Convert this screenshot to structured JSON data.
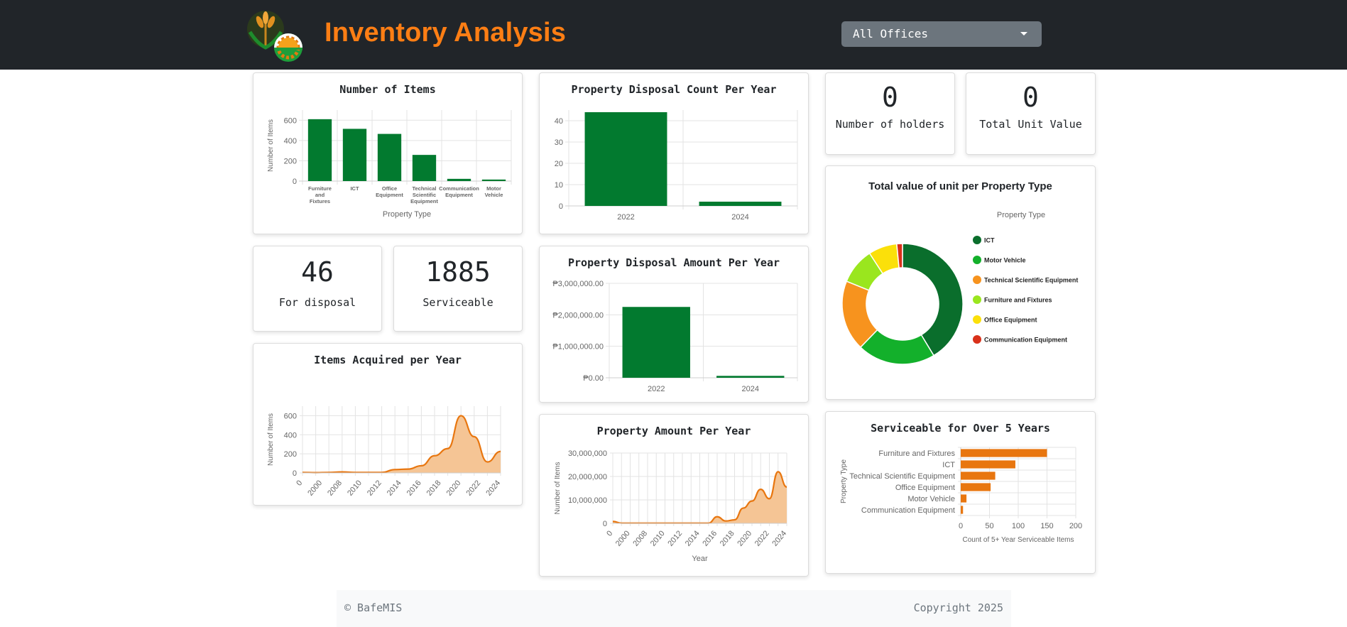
{
  "header": {
    "title": "Inventory Analysis",
    "office_filter": {
      "selected": "All Offices"
    }
  },
  "stats": {
    "for_disposal": {
      "value": "46",
      "label": "For disposal"
    },
    "serviceable": {
      "value": "1885",
      "label": "Serviceable"
    },
    "holders": {
      "value": "0",
      "label": "Number of holders"
    },
    "total_unit_value": {
      "value": "0",
      "label": "Total Unit Value"
    }
  },
  "cards": {
    "items_title": "Number of Items",
    "acquired_title": "Items Acquired per Year",
    "disposal_count_title": "Property Disposal Count Per Year",
    "disposal_amount_title": "Property Disposal Amount Per Year",
    "amount_title": "Property Amount Per Year",
    "donut_title": "Total value of unit per Property Type",
    "serviceable5_title": "Serviceable for Over 5 Years"
  },
  "colors": {
    "green": "#027a2f",
    "orange": "#e8760f",
    "orange_fill": "#f5c595",
    "navbar": "#212529",
    "brand": "#fd7e14"
  },
  "chart_data": [
    {
      "id": "items",
      "type": "bar",
      "title": "Number of Items",
      "xlabel": "Property Type",
      "ylabel": "Number of Items",
      "categories": [
        "Furniture and Fixtures",
        "ICT",
        "Office Equipment",
        "Technical Scientific Equipment",
        "Communication Equipment",
        "Motor Vehicle"
      ],
      "values": [
        610,
        515,
        465,
        258,
        22,
        15
      ],
      "ylim": [
        0,
        700
      ],
      "yticks": [
        0,
        200,
        400,
        600
      ],
      "grid": true
    },
    {
      "id": "acquired",
      "type": "area",
      "title": "Items Acquired per Year",
      "xlabel": "Year",
      "ylabel": "Number of Items",
      "x": [
        "0",
        "2000",
        "2008",
        "2010",
        "2012",
        "2014",
        "2016",
        "2018",
        "2020",
        "2022",
        "2024"
      ],
      "values": [
        5,
        3,
        5,
        10,
        5,
        5,
        5,
        35,
        40,
        75,
        180,
        255,
        600,
        380,
        115,
        225
      ],
      "ylim": [
        0,
        700
      ],
      "yticks": [
        0,
        200,
        400,
        600
      ],
      "grid": true
    },
    {
      "id": "disposal_count",
      "type": "bar",
      "title": "Property Disposal Count Per Year",
      "categories": [
        "2022",
        "2024"
      ],
      "values": [
        44,
        2
      ],
      "ylim": [
        0,
        45
      ],
      "yticks": [
        0,
        10,
        20,
        30,
        40
      ],
      "grid": true
    },
    {
      "id": "disposal_amount",
      "type": "bar",
      "title": "Property Disposal Amount Per Year",
      "categories": [
        "2022",
        "2024"
      ],
      "values": [
        2250000,
        60000
      ],
      "ylim": [
        0,
        3000000
      ],
      "yticks": [
        0,
        1000000,
        2000000,
        3000000
      ],
      "ytick_labels": [
        "₱0.00",
        "₱1,000,000.00",
        "₱2,000,000.00",
        "₱3,000,000.00"
      ],
      "grid": true
    },
    {
      "id": "amount",
      "type": "area",
      "title": "Property Amount Per Year",
      "xlabel": "Year",
      "ylabel": "Number of Items",
      "x": [
        "0",
        "2000",
        "2008",
        "2010",
        "2012",
        "2014",
        "2016",
        "2018",
        "2020",
        "2022",
        "2024"
      ],
      "values": [
        800000,
        100000,
        100000,
        100000,
        100000,
        100000,
        100000,
        100000,
        100000,
        100000,
        100000,
        100000,
        2800000,
        1000000,
        1500000,
        6500000,
        9500000,
        14500000,
        10500000,
        22000000,
        15500000
      ],
      "ylim": [
        0,
        30000000
      ],
      "yticks": [
        0,
        10000000,
        20000000,
        30000000
      ],
      "ytick_labels": [
        "0",
        "10,000,000",
        "20,000,000",
        "30,000,000"
      ],
      "grid": true
    },
    {
      "id": "donut",
      "type": "pie",
      "title": "Total value of unit per Property Type",
      "legend_title": "Property Type",
      "legend_position": "right",
      "labels": [
        "ICT",
        "Motor Vehicle",
        "Technical Scientific Equipment",
        "Furniture and Fixtures",
        "Office Equipment",
        "Communication Equipment"
      ],
      "values": [
        40.5,
        20.5,
        18.5,
        9.5,
        7.5,
        1.5
      ],
      "colors": [
        "#0a6e2c",
        "#13b02b",
        "#f7931e",
        "#9ae61e",
        "#fbe00a",
        "#d9311a"
      ]
    },
    {
      "id": "serviceable5",
      "type": "bar",
      "orientation": "horizontal",
      "title": "Serviceable for Over 5 Years",
      "xlabel": "Count of 5+ Year Serviceable Items",
      "ylabel": "Property Type",
      "categories": [
        "Furniture and Fixtures",
        "ICT",
        "Technical Scientific Equipment",
        "Office Equipment",
        "Motor Vehicle",
        "Communication Equipment"
      ],
      "values": [
        150,
        95,
        60,
        52,
        10,
        4
      ],
      "xlim": [
        0,
        200
      ],
      "xticks": [
        0,
        50,
        100,
        150,
        200
      ],
      "grid": true
    }
  ],
  "footer": {
    "left": "© BafeMIS",
    "right": "Copyright 2025"
  }
}
